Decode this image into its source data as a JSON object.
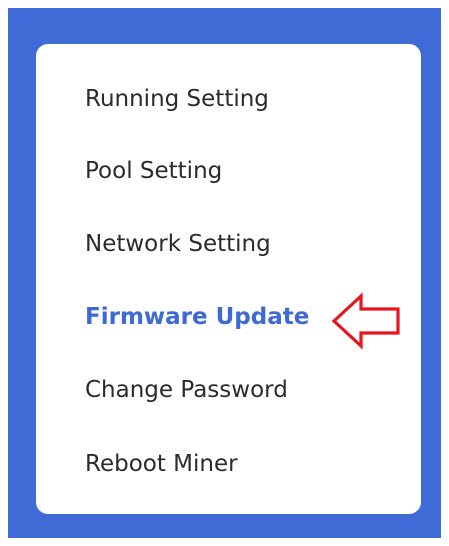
{
  "menu": {
    "items": [
      {
        "label": "Running Setting"
      },
      {
        "label": "Pool Setting"
      },
      {
        "label": "Network Setting"
      },
      {
        "label": "Firmware Update",
        "active": true
      },
      {
        "label": "Change Password"
      },
      {
        "label": "Reboot Miner"
      }
    ]
  },
  "annotation": {
    "icon": "left-arrow-icon",
    "color": "#e8141e"
  },
  "colors": {
    "background": "#3e6bd6",
    "card": "#ffffff",
    "active_text": "#3f6ad4",
    "text": "#2b2b2b"
  }
}
